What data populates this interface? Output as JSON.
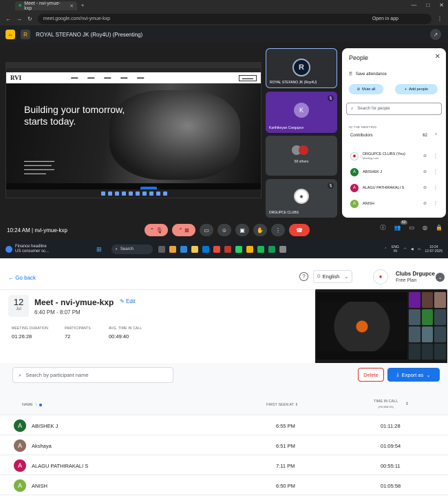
{
  "browser": {
    "tab_title": "Meet - nvi-ymue-kxp",
    "url": "meet.google.com/nvi-ymue-kxp",
    "open_in_app": "Open in app"
  },
  "presenting_bar": {
    "text": "ROYAL STEFANO JK (Roy4U) (Presenting)"
  },
  "shared_screen": {
    "headline_line1": "Building your tomorrow,",
    "headline_line2": "starts today.",
    "logo": "RVI"
  },
  "tiles": {
    "presenter_name": "ROYAL STEFANO JK (Roy4U)",
    "k_initial": "K",
    "k_name": "Karthikeyan Csegupce",
    "others": "58 others",
    "club_tile_name": "DRGUPCE CLUBS"
  },
  "people_panel": {
    "title": "People",
    "save_attendance": "Save attendance",
    "mute_all": "Mute all",
    "add_people": "Add people",
    "search_placeholder": "Search for people",
    "in_meeting": "IN THE MEETING",
    "contributors": "Contributors",
    "count": "62",
    "list": [
      {
        "initial": "",
        "name": "DRGUPCE CLUBS (You)",
        "sub": "Meeting host",
        "color": "#ffffff"
      },
      {
        "initial": "A",
        "name": "ABISHEK J",
        "sub": "",
        "color": "#1e7e34"
      },
      {
        "initial": "A",
        "name": "ALAGU PATHIRAKALI S",
        "sub": "",
        "color": "#c2185b"
      },
      {
        "initial": "A",
        "name": "ANISH",
        "sub": "",
        "color": "#7cb342"
      }
    ]
  },
  "meeting_bar": {
    "time_code": "10:24 AM  |  nvi-ymue-kxp",
    "participants_badge": "62"
  },
  "taskbar": {
    "weather_line1": "Finance headline",
    "weather_line2": "US consumer sc...",
    "search": "Search",
    "lang": "ENG IN",
    "clock_time": "10:24",
    "clock_date": "12-07-2025"
  },
  "report": {
    "go_back": "← Go back",
    "language": "English",
    "club_name": "Clubs Drgupce",
    "plan": "Free Plan",
    "day": "12",
    "month": "Jul",
    "title": "Meet - nvi-ymue-kxp",
    "edit": "Edit",
    "time_range": "6:40 PM - 8:07 PM",
    "stats": [
      {
        "label": "MEETING DURATION",
        "value": "01:26:28"
      },
      {
        "label": "PARTICIPANTS",
        "value": "72"
      },
      {
        "label": "AVG. TIME IN CALL",
        "value": "00:49:40"
      }
    ],
    "search_placeholder": "Search by participant name",
    "delete": "Delete",
    "export": "Export as",
    "columns": {
      "name": "NAME",
      "first_seen": "FIRST SEEN AT",
      "time_in_call": "TIME IN CALL",
      "time_unit": "(HH:MM:SS)"
    },
    "rows": [
      {
        "initial": "A",
        "name": "ABISHEK J",
        "first_seen": "6:55 PM",
        "time": "01:11:28",
        "color": "#1e6b2f"
      },
      {
        "initial": "A",
        "name": "Akshaya",
        "first_seen": "6:51 PM",
        "time": "01:09:54",
        "color": "#8d6e63"
      },
      {
        "initial": "A",
        "name": "ALAGU PATHIRAKALI S",
        "first_seen": "7:11 PM",
        "time": "00:55:11",
        "color": "#c2185b"
      },
      {
        "initial": "A",
        "name": "ANISH",
        "first_seen": "6:50 PM",
        "time": "01:05:58",
        "color": "#7cb342"
      }
    ]
  }
}
